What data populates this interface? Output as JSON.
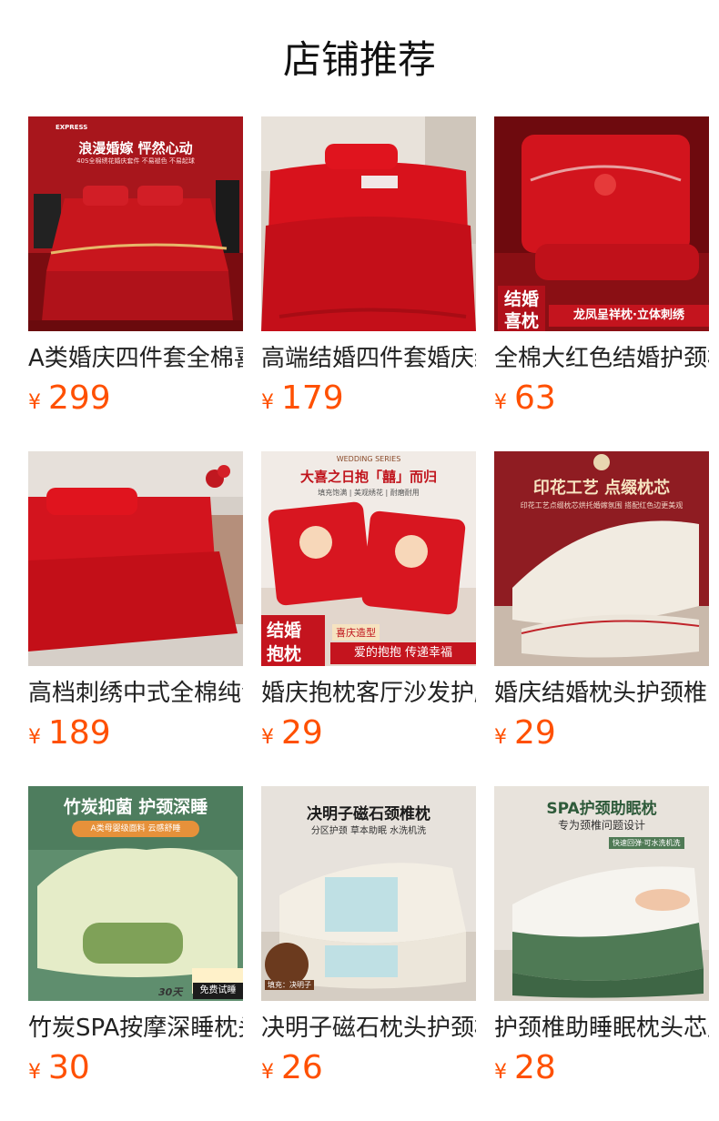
{
  "section": {
    "title": "店铺推荐"
  },
  "currency": "¥",
  "products": [
    {
      "name": "A类婚庆四件套全棉喜",
      "price": "299",
      "overlay": [
        "EXPRESS",
        "浪漫婚嫁 怦然心动",
        "40S全棉绣花婚庆套件 不易褪色 不易起球"
      ]
    },
    {
      "name": "高端结婚四件套婚庆红",
      "price": "179",
      "overlay": []
    },
    {
      "name": "全棉大红色结婚护颈枕",
      "price": "63",
      "overlay": [
        "结婚",
        "喜枕",
        "龙凤呈祥枕·立体刺绣"
      ]
    },
    {
      "name": "高档刺绣中式全棉纯色",
      "price": "189",
      "overlay": []
    },
    {
      "name": "婚庆抱枕客厅沙发护腰",
      "price": "29",
      "overlay": [
        "WEDDING SERIES",
        "大喜之日抱「囍」而归",
        "填充饱满 | 美观绣花 | 耐磨耐用",
        "结婚",
        "抱枕",
        "喜庆造型",
        "爱的抱抱 传递幸福"
      ]
    },
    {
      "name": "婚庆结婚枕头护颈椎",
      "price": "29",
      "overlay": [
        "印花工艺 点缀枕芯",
        "印花工艺点缀枕芯烘托婚嫁氛围 搭配红色边更美观"
      ]
    },
    {
      "name": "竹炭SPA按摩深睡枕头",
      "price": "30",
      "overlay": [
        "竹炭抑菌 护颈深睡",
        "A类母婴级面料 云感舒睡",
        "30天",
        "免费试睡"
      ]
    },
    {
      "name": "决明子磁石枕头护颈椎",
      "price": "26",
      "overlay": [
        "决明子磁石颈椎枕",
        "分区护颈 草本助眠 水洗机洗",
        "填充：决明子"
      ]
    },
    {
      "name": "护颈椎助睡眠枕头芯成",
      "price": "28",
      "overlay": [
        "SPA护颈助眠枕",
        "专为颈椎问题设计",
        "快速回弹·可水洗机洗"
      ]
    }
  ]
}
